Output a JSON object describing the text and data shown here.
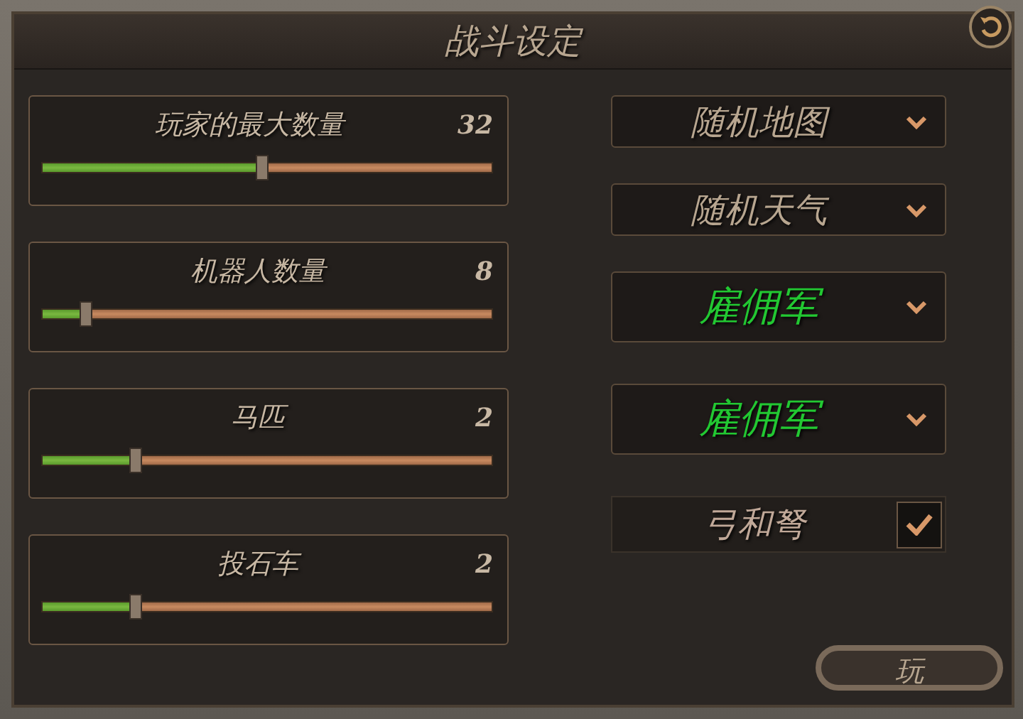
{
  "window": {
    "title": "战斗设定"
  },
  "sliders": [
    {
      "label": "玩家的最大数量",
      "value": "32",
      "level": 0.49
    },
    {
      "label": "机器人数量",
      "value": "8",
      "level": 0.1
    },
    {
      "label": "马匹",
      "value": "2",
      "level": 0.21
    },
    {
      "label": "投石车",
      "value": "2",
      "level": 0.21
    }
  ],
  "options": [
    {
      "kind": "dropdown",
      "label": "随机地图"
    },
    {
      "kind": "dropdown",
      "label": "随机天气"
    },
    {
      "kind": "faction",
      "label": "雇佣军"
    },
    {
      "kind": "faction",
      "label": "雇佣军"
    },
    {
      "kind": "checkbox",
      "label": "弓和弩",
      "checked": true
    }
  ],
  "play_button": "玩"
}
